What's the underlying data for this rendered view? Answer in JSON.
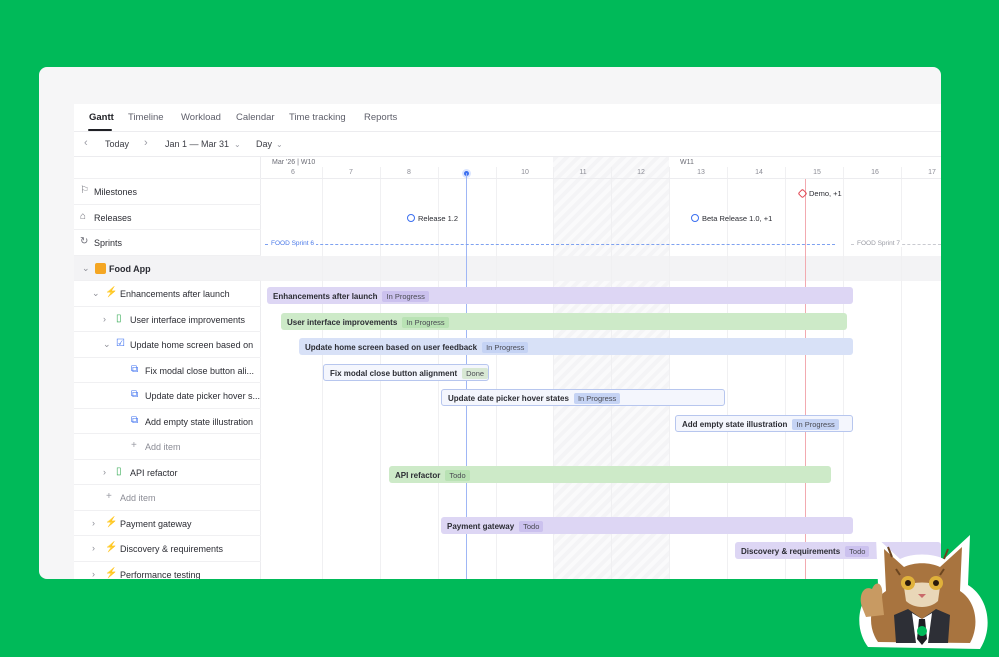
{
  "tabs": [
    "Gantt",
    "Timeline",
    "Workload",
    "Calendar",
    "Time tracking",
    "Reports"
  ],
  "toolbar": {
    "prev_icon": "chevron-left-icon",
    "today": "Today",
    "next_icon": "chevron-right-icon",
    "range": "Jan 1 — Mar 31",
    "zoom": "Day"
  },
  "header": {
    "week1": "Mar '26 | W10",
    "week2": "W11",
    "days": [
      "6",
      "7",
      "8",
      "9",
      "10",
      "11",
      "12",
      "13",
      "14",
      "15",
      "16",
      "17"
    ]
  },
  "rows": {
    "milestones": "Milestones",
    "releases": "Releases",
    "sprints": "Sprints",
    "project": "Food App",
    "enhancements": "Enhancements after launch",
    "ui_improvements": "User interface improvements",
    "update_home": "Update home screen based on",
    "fix_modal": "Fix modal close button ali...",
    "update_date": "Update date picker hover s...",
    "add_empty": "Add empty state illustration",
    "add_item_1": "Add item",
    "api_refactor": "API refactor",
    "add_item_2": "Add item",
    "payment": "Payment gateway",
    "discovery": "Discovery & requirements",
    "performance": "Performance testing"
  },
  "milestones": {
    "demo": "Demo, +1",
    "release_12": "Release 1.2",
    "beta": "Beta Release 1.0, +1"
  },
  "sprints": {
    "sprint6": "FOOD Sprint 6",
    "sprint7": "FOOD Sprint 7"
  },
  "bars": {
    "enhancements": {
      "label": "Enhancements after launch",
      "status": "In Progress"
    },
    "ui_improvements": {
      "label": "User interface improvements",
      "status": "In Progress"
    },
    "update_home": {
      "label": "Update home screen based on user feedback",
      "status": "In Progress"
    },
    "fix_modal": {
      "label": "Fix modal close button alignment",
      "status": "Done"
    },
    "update_date": {
      "label": "Update date picker hover states",
      "status": "In Progress"
    },
    "add_empty": {
      "label": "Add empty state illustration",
      "status": "In Progress"
    },
    "api_refactor": {
      "label": "API refactor",
      "status": "Todo"
    },
    "payment": {
      "label": "Payment gateway",
      "status": "Todo"
    },
    "discovery": {
      "label": "Discovery & requirements",
      "status": "Todo"
    }
  },
  "colors": {
    "background": "#00BA59",
    "today": "#3b6ff0",
    "purple_bar": "#ddd6f4",
    "green_bar": "#cdeac8",
    "blue_bar": "#d8e1f7"
  }
}
